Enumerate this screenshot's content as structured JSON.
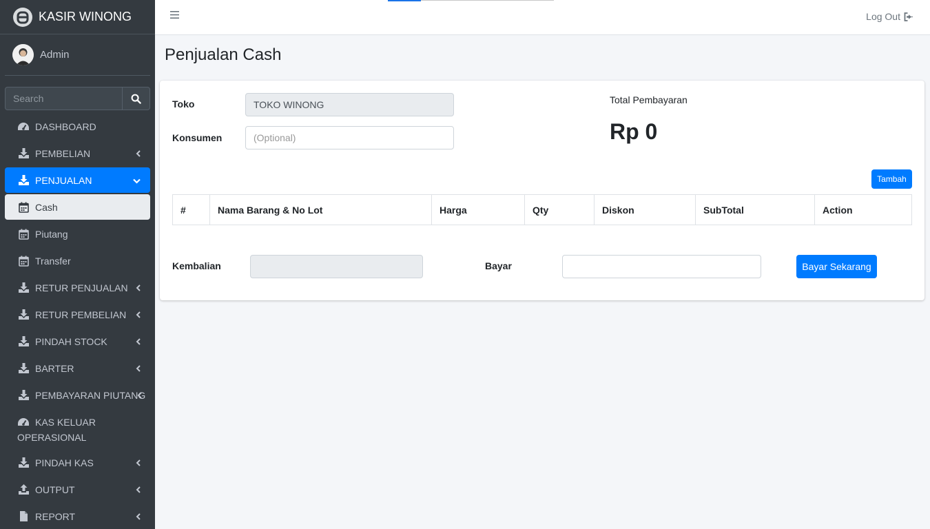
{
  "brand": {
    "title": "KASIR WINONG"
  },
  "user": {
    "name": "Admin"
  },
  "search": {
    "placeholder": "Search"
  },
  "sidebar": {
    "items": [
      {
        "label": "DASHBOARD",
        "icon": "tachometer-icon"
      },
      {
        "label": "PEMBELIAN",
        "icon": "download-icon"
      },
      {
        "label": "PENJUALAN",
        "icon": "download-icon"
      },
      {
        "label": "Cash",
        "icon": "calendar-icon"
      },
      {
        "label": "Piutang",
        "icon": "calendar-icon"
      },
      {
        "label": "Transfer",
        "icon": "calendar-icon"
      },
      {
        "label": "RETUR PENJUALAN",
        "icon": "download-icon"
      },
      {
        "label": "RETUR PEMBELIAN",
        "icon": "download-icon"
      },
      {
        "label": "PINDAH STOCK",
        "icon": "download-icon"
      },
      {
        "label": "BARTER",
        "icon": "download-icon"
      },
      {
        "label": "PEMBAYARAN PIUTANG",
        "icon": "download-icon"
      },
      {
        "label": "KAS KELUAR OPERASIONAL",
        "icon": "tachometer-icon"
      },
      {
        "label": "PINDAH KAS",
        "icon": "download-icon"
      },
      {
        "label": "OUTPUT",
        "icon": "upload-icon"
      },
      {
        "label": "REPORT",
        "icon": "file-icon"
      }
    ]
  },
  "header": {
    "logout_label": "Log Out"
  },
  "page": {
    "title": "Penjualan Cash"
  },
  "form": {
    "toko_label": "Toko",
    "toko_value": "TOKO WINONG",
    "konsumen_label": "Konsumen",
    "konsumen_placeholder": "(Optional)",
    "total_label": "Total Pembayaran",
    "total_value": "Rp 0",
    "tambah_label": "Tambah",
    "kembalian_label": "Kembalian",
    "kembalian_value": "",
    "bayar_label": "Bayar",
    "bayar_value": "",
    "bayar_button": "Bayar Sekarang"
  },
  "table": {
    "headers": [
      "#",
      "Nama Barang & No Lot",
      "Harga",
      "Qty",
      "Diskon",
      "SubTotal",
      "Action"
    ],
    "rows": []
  },
  "colors": {
    "primary": "#007bff",
    "sidebar": "#343a40",
    "content_bg": "#f4f6f9"
  }
}
